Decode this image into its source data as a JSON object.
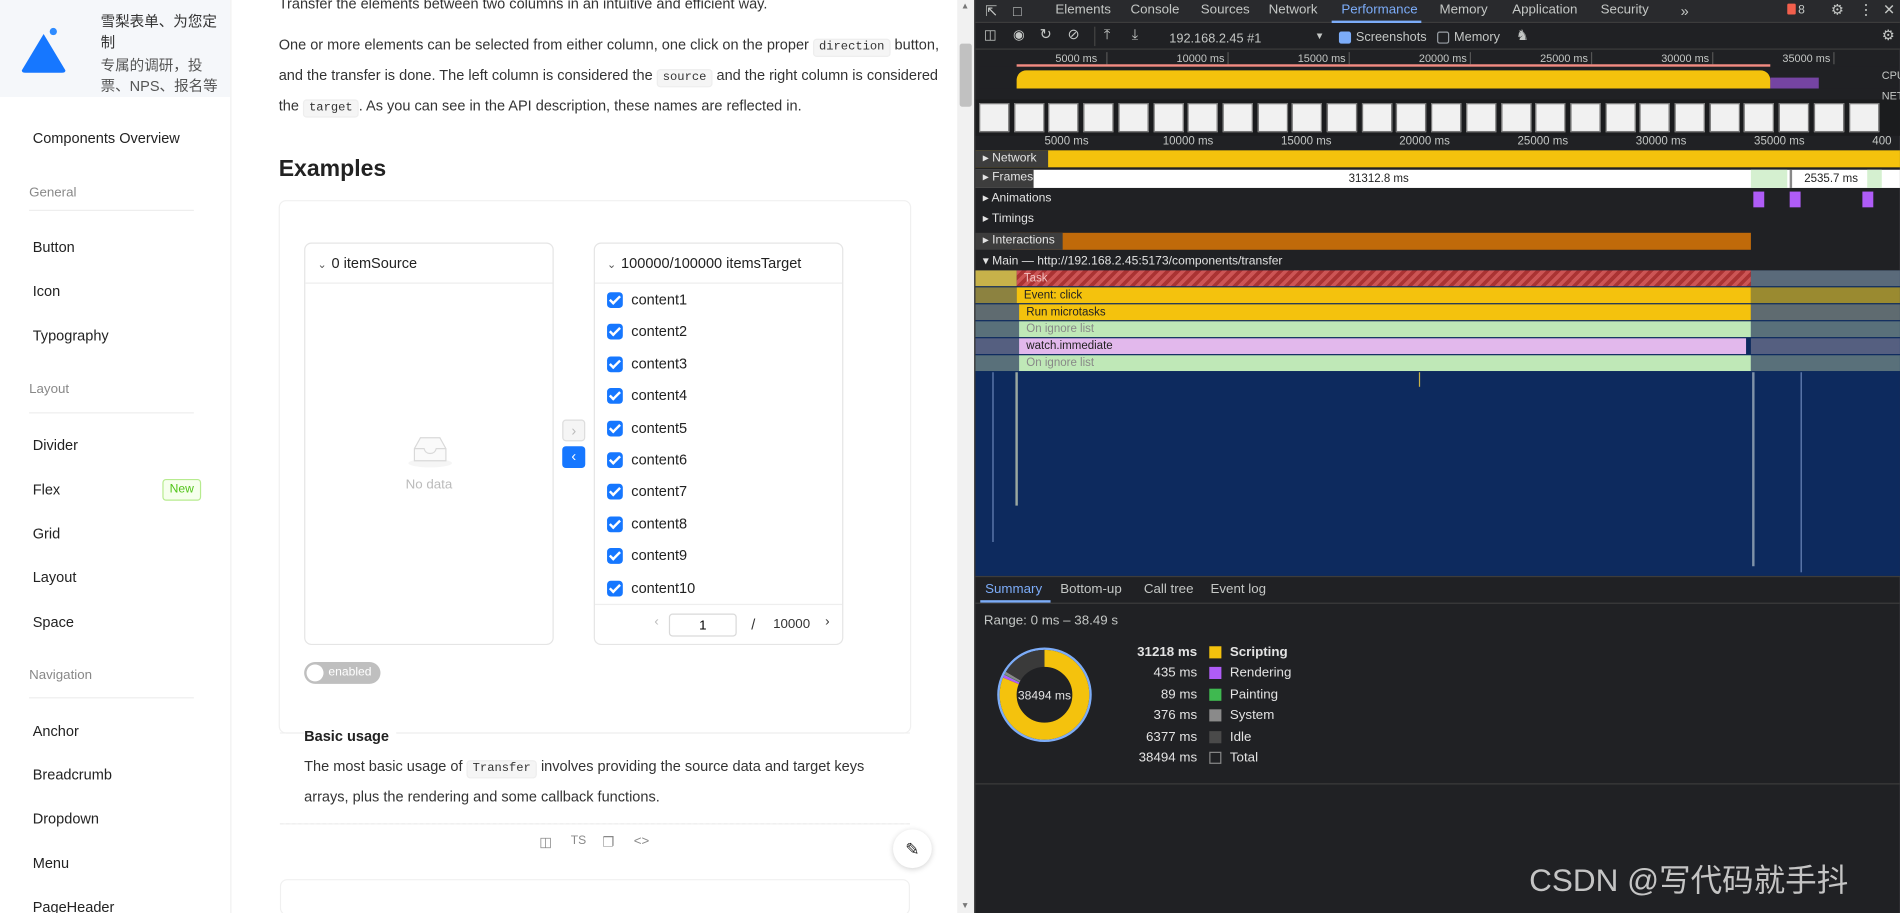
{
  "sidebar": {
    "ad_title": "雪梨表单、为您定制",
    "ad_subtitle": "专属的调研，投票、NPS、报名等",
    "items": {
      "overview": "Components Overview",
      "group_general": "General",
      "button": "Button",
      "icon": "Icon",
      "typography": "Typography",
      "group_layout": "Layout",
      "divider": "Divider",
      "flex": "Flex",
      "flex_badge": "New",
      "grid": "Grid",
      "layout": "Layout",
      "space": "Space",
      "group_navigation": "Navigation",
      "anchor": "Anchor",
      "breadcrumb": "Breadcrumb",
      "dropdown": "Dropdown",
      "menu": "Menu",
      "pageheader": "PageHeader"
    }
  },
  "content": {
    "intro_top": "Transfer the elements between two columns in an intuitive and efficient way.",
    "p1_a": "One or more elements can be selected from either column, one click on the proper",
    "p1_code1": "direction",
    "p1_b": "button, and the transfer is done. The left column is considered the",
    "p1_code2": "source",
    "p1_c": "and the right column is",
    "p1_d": "considered the",
    "p1_code3": "target",
    "p1_e": ". As you can see in the API description, these names are reflected in.",
    "examples_heading": "Examples",
    "source_header": "0 itemSource",
    "target_header": "100000/100000 itemsTarget",
    "no_data": "No data",
    "target_items": [
      "content1",
      "content2",
      "content3",
      "content4",
      "content5",
      "content6",
      "content7",
      "content8",
      "content9",
      "content10"
    ],
    "page_current": "1",
    "page_sep": "/",
    "page_total": "10000",
    "toggle_label": "enabled",
    "basic_title": "Basic usage",
    "basic_a": "The most basic usage of",
    "basic_code": "Transfer",
    "basic_b": "involves providing the source data and target keys arrays,",
    "basic_c": "plus the rendering and some callback functions.",
    "code_action_ts": "TS"
  },
  "devtools": {
    "tabs": [
      "Elements",
      "Console",
      "Sources",
      "Network",
      "Performance",
      "Memory",
      "Application",
      "Security"
    ],
    "active_tab": "Performance",
    "issues_count": "8",
    "target_select": "192.168.2.45 #1",
    "screenshots_label": "Screenshots",
    "memory_label": "Memory",
    "overview_ticks": [
      "5000 ms",
      "10000 ms",
      "15000 ms",
      "20000 ms",
      "25000 ms",
      "30000 ms",
      "35000 ms"
    ],
    "cpu_label": "CPU",
    "net_label": "NET",
    "ruler_ticks": [
      "5000 ms",
      "10000 ms",
      "15000 ms",
      "20000 ms",
      "25000 ms",
      "30000 ms",
      "35000 ms",
      "400"
    ],
    "tracks": {
      "network": "Network",
      "frames": "Frames",
      "frame1": "31312.8 ms",
      "frame2": "2535.7 ms",
      "animations": "Animations",
      "timings": "Timings",
      "interactions": "Interactions",
      "main": "Main — http://192.168.2.45:5173/components/transfer"
    },
    "flame": {
      "task": "Task",
      "event_click": "Event: click",
      "microtasks": "Run microtasks",
      "ignore1": "On ignore list",
      "watch": "watch.immediate",
      "ignore2": "On ignore list"
    },
    "bottom_tabs": [
      "Summary",
      "Bottom-up",
      "Call tree",
      "Event log"
    ],
    "range": "Range: 0 ms – 38.49 s",
    "donut_center": "38494 ms",
    "summary": [
      {
        "ms": "31218 ms",
        "label": "Scripting",
        "color": "#f4c20d",
        "bold": true
      },
      {
        "ms": "435 ms",
        "label": "Rendering",
        "color": "#af5cf7"
      },
      {
        "ms": "89 ms",
        "label": "Painting",
        "color": "#3fb950"
      },
      {
        "ms": "376 ms",
        "label": "System",
        "color": "#8a8a8a"
      },
      {
        "ms": "6377 ms",
        "label": "Idle",
        "color": "#4a4a4a"
      },
      {
        "ms": "38494 ms",
        "label": "Total",
        "color": "#202124"
      }
    ]
  },
  "watermark": "CSDN @写代码就手抖"
}
